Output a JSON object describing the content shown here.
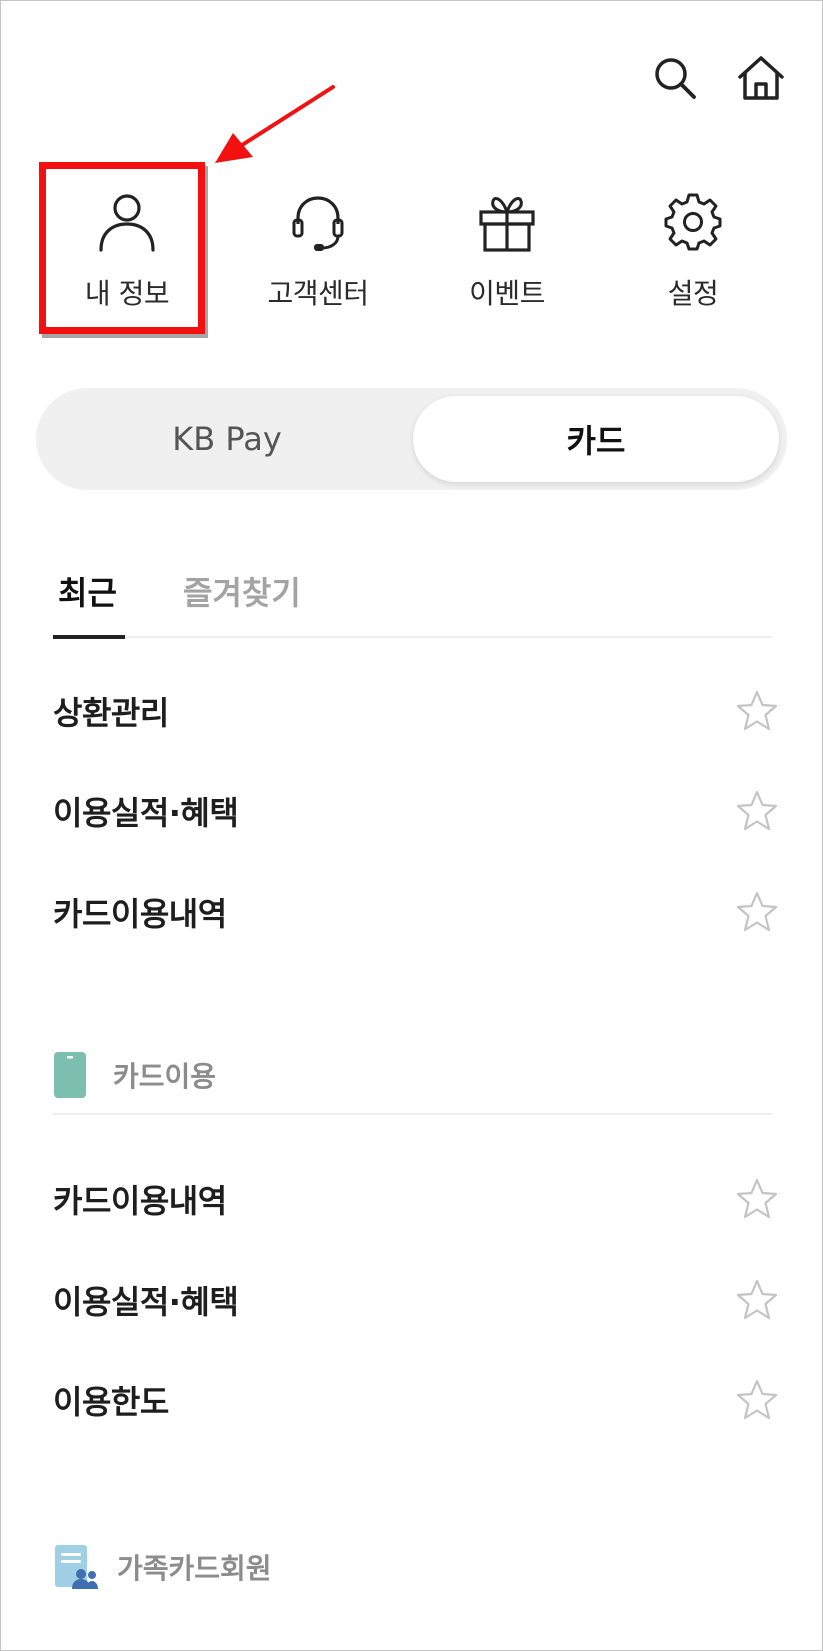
{
  "header": {
    "icons": [
      "search-icon",
      "home-icon"
    ]
  },
  "quick_menu": [
    {
      "label": "내 정보",
      "icon": "person-icon"
    },
    {
      "label": "고객센터",
      "icon": "headset-icon"
    },
    {
      "label": "이벤트",
      "icon": "gift-icon"
    },
    {
      "label": "설정",
      "icon": "gear-icon"
    }
  ],
  "segment": {
    "options": [
      "KB Pay",
      "카드"
    ],
    "selected": "카드"
  },
  "tabs": {
    "items": [
      "최근",
      "즐겨찾기"
    ],
    "active": "최근"
  },
  "recent_items": [
    "상환관리",
    "이용실적·혜택",
    "카드이용내역"
  ],
  "sections": [
    {
      "title": "카드이용",
      "icon": "card-icon",
      "items": [
        "카드이용내역",
        "이용실적·혜택",
        "이용한도"
      ]
    },
    {
      "title": "가족카드회원",
      "icon": "family-card-icon",
      "items": []
    }
  ],
  "colors": {
    "highlight": "#f21010",
    "card_icon": "#7dbfae",
    "family_icon": "#6ab3d6"
  }
}
